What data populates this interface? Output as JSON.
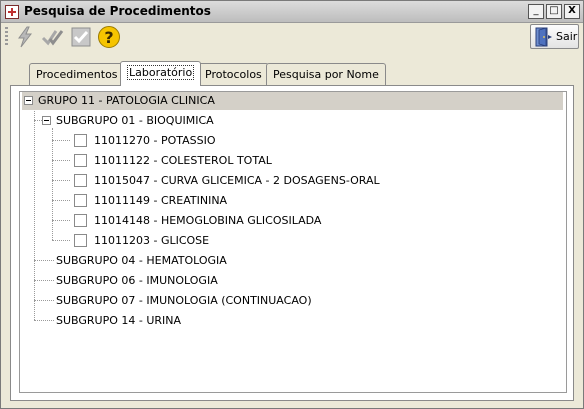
{
  "window": {
    "title": "Pesquisa de Procedimentos",
    "minimize_glyph": "_",
    "maximize_glyph": "□",
    "close_glyph": "X"
  },
  "toolbar": {
    "tools": [
      {
        "name": "lightning-icon"
      },
      {
        "name": "double-check-icon"
      },
      {
        "name": "checkbox-check-icon"
      },
      {
        "name": "help-icon"
      }
    ],
    "exit_label": "Sair"
  },
  "tabs": [
    {
      "label": "Procedimentos",
      "active": false
    },
    {
      "label": "Laboratório",
      "active": true
    },
    {
      "label": "Protocolos",
      "active": false
    },
    {
      "label": "Pesquisa por Nome",
      "active": false
    }
  ],
  "tree": {
    "root": {
      "label": "GRUPO 11 - PATOLOGIA CLINICA",
      "expanded": true
    },
    "subgroups": [
      {
        "label": "SUBGRUPO 01 - BIOQUIMICA",
        "expanded": true,
        "items": [
          {
            "label": "11011270 - POTASSIO",
            "checked": false
          },
          {
            "label": "11011122 - COLESTEROL TOTAL",
            "checked": false
          },
          {
            "label": "11015047 - CURVA GLICEMICA - 2 DOSAGENS-ORAL",
            "checked": false
          },
          {
            "label": "11011149 - CREATININA",
            "checked": false
          },
          {
            "label": "11014148 - HEMOGLOBINA GLICOSILADA",
            "checked": false
          },
          {
            "label": "11011203 - GLICOSE",
            "checked": false
          }
        ]
      },
      {
        "label": "SUBGRUPO 04 - HEMATOLOGIA",
        "expanded": false
      },
      {
        "label": "SUBGRUPO 06 - IMUNOLOGIA",
        "expanded": false
      },
      {
        "label": "SUBGRUPO 07 - IMUNOLOGIA (CONTINUACAO)",
        "expanded": false
      },
      {
        "label": "SUBGRUPO 14 - URINA",
        "expanded": false
      }
    ]
  },
  "colors": {
    "window_bg": "#ece9d8",
    "selected_row_bg": "#d4d0c8",
    "help_icon": "#f5c400"
  }
}
